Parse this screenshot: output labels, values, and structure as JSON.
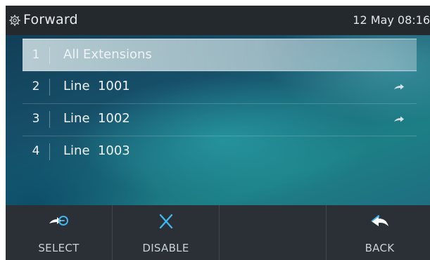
{
  "titlebar": {
    "title": "Forward",
    "clock": "12 May 08:16",
    "icon": "gear-icon"
  },
  "list": {
    "items": [
      {
        "number": "1",
        "label": "All Extensions",
        "selected": true,
        "forward_icon": false
      },
      {
        "number": "2",
        "label": "Line  1001",
        "selected": false,
        "forward_icon": true
      },
      {
        "number": "3",
        "label": "Line  1002",
        "selected": false,
        "forward_icon": true
      },
      {
        "number": "4",
        "label": "Line  1003",
        "selected": false,
        "forward_icon": false
      }
    ]
  },
  "softkeys": {
    "select_label": "SELECT",
    "disable_label": "DISABLE",
    "empty_label": "",
    "back_label": "BACK"
  },
  "colors": {
    "accent": "#3fb6f0",
    "titlebar_bg": "#24292d",
    "softkey_bg": "#2a3035"
  }
}
